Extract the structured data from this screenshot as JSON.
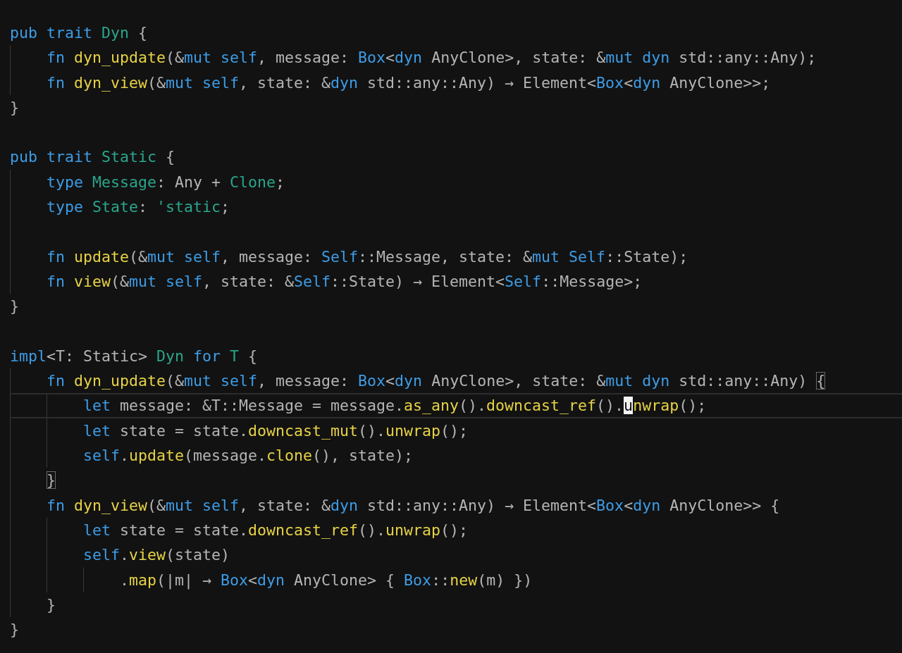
{
  "editor": {
    "lines": [
      {
        "kind": "code",
        "tokens": [
          {
            "kind": "kw",
            "text": "pub trait "
          },
          {
            "kind": "type",
            "text": "Dyn"
          },
          {
            "kind": "plain",
            "text": " {"
          }
        ],
        "children": [
          {
            "kind": "code",
            "tokens": [
              {
                "kind": "kw",
                "text": "fn "
              },
              {
                "kind": "fn",
                "text": "dyn_update"
              },
              {
                "kind": "plain",
                "text": "(&"
              },
              {
                "kind": "kw",
                "text": "mut self"
              },
              {
                "kind": "plain",
                "text": ", message: "
              },
              {
                "kind": "kw",
                "text": "Box"
              },
              {
                "kind": "plain",
                "text": "<"
              },
              {
                "kind": "kw",
                "text": "dyn"
              },
              {
                "kind": "plain",
                "text": " AnyClone>, state: &"
              },
              {
                "kind": "kw",
                "text": "mut dyn"
              },
              {
                "kind": "plain",
                "text": " std::any::Any);"
              }
            ]
          },
          {
            "kind": "code",
            "tokens": [
              {
                "kind": "kw",
                "text": "fn "
              },
              {
                "kind": "fn",
                "text": "dyn_view"
              },
              {
                "kind": "plain",
                "text": "(&"
              },
              {
                "kind": "kw",
                "text": "mut self"
              },
              {
                "kind": "plain",
                "text": ", state: &"
              },
              {
                "kind": "kw",
                "text": "dyn"
              },
              {
                "kind": "plain",
                "text": " std::any::Any) → Element<"
              },
              {
                "kind": "kw",
                "text": "Box"
              },
              {
                "kind": "plain",
                "text": "<"
              },
              {
                "kind": "kw",
                "text": "dyn"
              },
              {
                "kind": "plain",
                "text": " AnyClone>>;"
              }
            ]
          }
        ]
      },
      {
        "kind": "code",
        "tokens": [
          {
            "kind": "plain",
            "text": "}"
          }
        ]
      },
      {
        "kind": "blank"
      },
      {
        "kind": "code",
        "tokens": [
          {
            "kind": "kw",
            "text": "pub trait "
          },
          {
            "kind": "type",
            "text": "Static"
          },
          {
            "kind": "plain",
            "text": " {"
          }
        ],
        "children": [
          {
            "kind": "code",
            "tokens": [
              {
                "kind": "kw",
                "text": "type "
              },
              {
                "kind": "type",
                "text": "Message"
              },
              {
                "kind": "plain",
                "text": ": Any + "
              },
              {
                "kind": "type",
                "text": "Clone"
              },
              {
                "kind": "plain",
                "text": ";"
              }
            ]
          },
          {
            "kind": "code",
            "tokens": [
              {
                "kind": "kw",
                "text": "type "
              },
              {
                "kind": "type",
                "text": "State"
              },
              {
                "kind": "plain",
                "text": ": "
              },
              {
                "kind": "type",
                "text": "'static"
              },
              {
                "kind": "plain",
                "text": ";"
              }
            ]
          },
          {
            "kind": "blank"
          },
          {
            "kind": "code",
            "tokens": [
              {
                "kind": "kw",
                "text": "fn "
              },
              {
                "kind": "fn",
                "text": "update"
              },
              {
                "kind": "plain",
                "text": "(&"
              },
              {
                "kind": "kw",
                "text": "mut self"
              },
              {
                "kind": "plain",
                "text": ", message: "
              },
              {
                "kind": "kw",
                "text": "Self"
              },
              {
                "kind": "plain",
                "text": "::Message, state: &"
              },
              {
                "kind": "kw",
                "text": "mut Self"
              },
              {
                "kind": "plain",
                "text": "::State);"
              }
            ]
          },
          {
            "kind": "code",
            "tokens": [
              {
                "kind": "kw",
                "text": "fn "
              },
              {
                "kind": "fn",
                "text": "view"
              },
              {
                "kind": "plain",
                "text": "(&"
              },
              {
                "kind": "kw",
                "text": "mut self"
              },
              {
                "kind": "plain",
                "text": ", state: &"
              },
              {
                "kind": "kw",
                "text": "Self"
              },
              {
                "kind": "plain",
                "text": "::State) → Element<"
              },
              {
                "kind": "kw",
                "text": "Self"
              },
              {
                "kind": "plain",
                "text": "::Message>;"
              }
            ]
          }
        ]
      },
      {
        "kind": "code",
        "tokens": [
          {
            "kind": "plain",
            "text": "}"
          }
        ]
      },
      {
        "kind": "blank"
      },
      {
        "kind": "code",
        "tokens": [
          {
            "kind": "kw",
            "text": "impl"
          },
          {
            "kind": "plain",
            "text": "<T: Static> "
          },
          {
            "kind": "type",
            "text": "Dyn"
          },
          {
            "kind": "kw",
            "text": " for "
          },
          {
            "kind": "type",
            "text": "T"
          },
          {
            "kind": "plain",
            "text": " {"
          }
        ],
        "children": [
          {
            "kind": "code",
            "tokens": [
              {
                "kind": "kw",
                "text": "fn "
              },
              {
                "kind": "fn",
                "text": "dyn_update"
              },
              {
                "kind": "plain",
                "text": "(&"
              },
              {
                "kind": "kw",
                "text": "mut self"
              },
              {
                "kind": "plain",
                "text": ", message: "
              },
              {
                "kind": "kw",
                "text": "Box"
              },
              {
                "kind": "plain",
                "text": "<"
              },
              {
                "kind": "kw",
                "text": "dyn"
              },
              {
                "kind": "plain",
                "text": " AnyClone>, state: &"
              },
              {
                "kind": "kw",
                "text": "mut dyn"
              },
              {
                "kind": "plain",
                "text": " std::any::Any) "
              },
              {
                "kind": "match",
                "text": "{"
              }
            ],
            "children": [
              {
                "kind": "code",
                "current": true,
                "tokens": [
                  {
                    "kind": "kw",
                    "text": "let"
                  },
                  {
                    "kind": "plain",
                    "text": " message: &T::Message = message."
                  },
                  {
                    "kind": "fn",
                    "text": "as_any"
                  },
                  {
                    "kind": "plain",
                    "text": "()."
                  },
                  {
                    "kind": "fn",
                    "text": "downcast_ref"
                  },
                  {
                    "kind": "plain",
                    "text": "()."
                  },
                  {
                    "kind": "cursor",
                    "text": "u"
                  },
                  {
                    "kind": "fn",
                    "text": "nwrap"
                  },
                  {
                    "kind": "plain",
                    "text": "();"
                  }
                ]
              },
              {
                "kind": "code",
                "current": false,
                "tokens": [
                  {
                    "kind": "kw",
                    "text": "let"
                  },
                  {
                    "kind": "plain",
                    "text": " state = state."
                  },
                  {
                    "kind": "fn",
                    "text": "downcast_mut"
                  },
                  {
                    "kind": "plain",
                    "text": "()."
                  },
                  {
                    "kind": "fn",
                    "text": "unwrap"
                  },
                  {
                    "kind": "plain",
                    "text": "();"
                  }
                ]
              },
              {
                "kind": "code",
                "current": false,
                "tokens": [
                  {
                    "kind": "kw",
                    "text": "self"
                  },
                  {
                    "kind": "plain",
                    "text": "."
                  },
                  {
                    "kind": "fn",
                    "text": "update"
                  },
                  {
                    "kind": "plain",
                    "text": "(message."
                  },
                  {
                    "kind": "fn",
                    "text": "clone"
                  },
                  {
                    "kind": "plain",
                    "text": "(), state);"
                  }
                ]
              }
            ]
          },
          {
            "kind": "code",
            "tokens": [
              {
                "kind": "match",
                "text": "}"
              }
            ]
          },
          {
            "kind": "code",
            "tokens": [
              {
                "kind": "kw",
                "text": "fn "
              },
              {
                "kind": "fn",
                "text": "dyn_view"
              },
              {
                "kind": "plain",
                "text": "(&"
              },
              {
                "kind": "kw",
                "text": "mut self"
              },
              {
                "kind": "plain",
                "text": ", state: &"
              },
              {
                "kind": "kw",
                "text": "dyn"
              },
              {
                "kind": "plain",
                "text": " std::any::Any) → Element<"
              },
              {
                "kind": "kw",
                "text": "Box"
              },
              {
                "kind": "plain",
                "text": "<"
              },
              {
                "kind": "kw",
                "text": "dyn"
              },
              {
                "kind": "plain",
                "text": " AnyClone>> {"
              }
            ],
            "children": [
              {
                "kind": "code",
                "tokens": [
                  {
                    "kind": "kw",
                    "text": "let"
                  },
                  {
                    "kind": "plain",
                    "text": " state = state."
                  },
                  {
                    "kind": "fn",
                    "text": "downcast_ref"
                  },
                  {
                    "kind": "plain",
                    "text": "()."
                  },
                  {
                    "kind": "fn",
                    "text": "unwrap"
                  },
                  {
                    "kind": "plain",
                    "text": "();"
                  }
                ]
              },
              {
                "kind": "code",
                "tokens": [
                  {
                    "kind": "kw",
                    "text": "self"
                  },
                  {
                    "kind": "plain",
                    "text": "."
                  },
                  {
                    "kind": "fn",
                    "text": "view"
                  },
                  {
                    "kind": "plain",
                    "text": "(state)"
                  }
                ],
                "children": [
                  {
                    "kind": "code",
                    "tokens": [
                      {
                        "kind": "plain",
                        "text": "."
                      },
                      {
                        "kind": "fn",
                        "text": "map"
                      },
                      {
                        "kind": "plain",
                        "text": "(|m| → "
                      },
                      {
                        "kind": "kw",
                        "text": "Box"
                      },
                      {
                        "kind": "plain",
                        "text": "<"
                      },
                      {
                        "kind": "kw",
                        "text": "dyn"
                      },
                      {
                        "kind": "plain",
                        "text": " AnyClone> { "
                      },
                      {
                        "kind": "kw",
                        "text": "Box"
                      },
                      {
                        "kind": "plain",
                        "text": "::"
                      },
                      {
                        "kind": "fn",
                        "text": "new"
                      },
                      {
                        "kind": "plain",
                        "text": "(m) })"
                      }
                    ]
                  }
                ]
              }
            ]
          },
          {
            "kind": "code",
            "tokens": [
              {
                "kind": "plain",
                "text": "}"
              }
            ]
          }
        ]
      },
      {
        "kind": "code",
        "tokens": [
          {
            "kind": "plain",
            "text": "}"
          }
        ]
      }
    ]
  }
}
